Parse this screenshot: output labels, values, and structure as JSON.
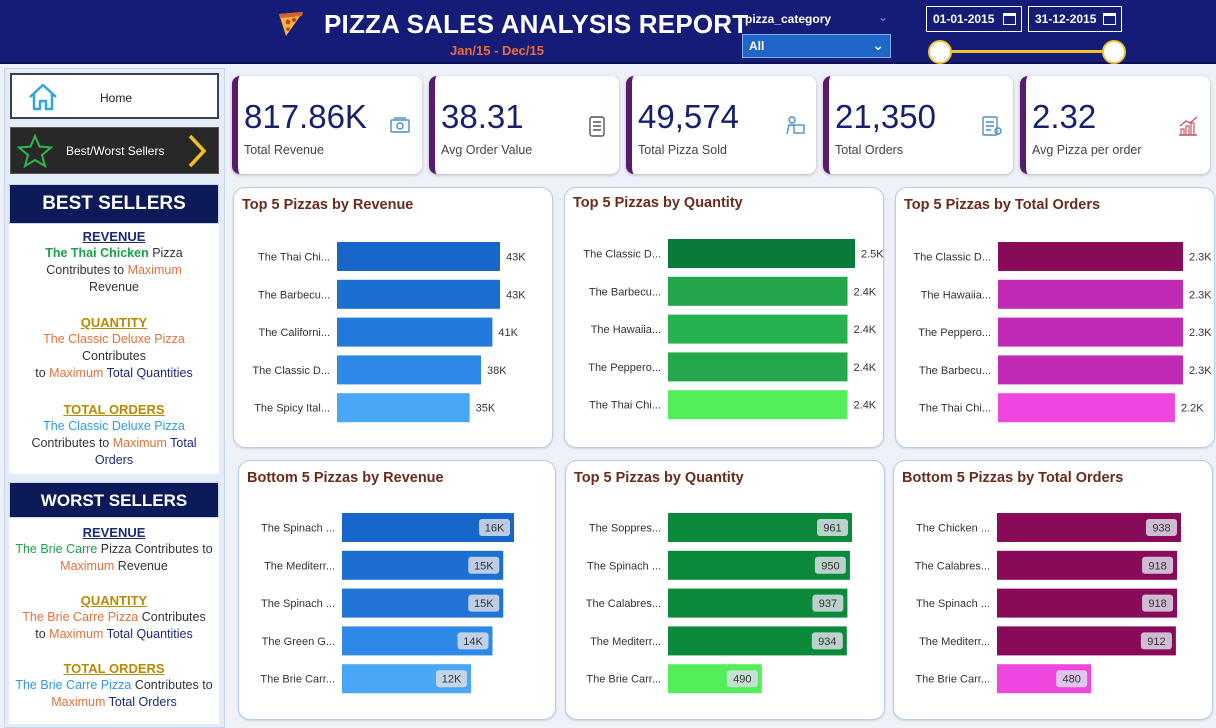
{
  "header": {
    "title": "PIZZA SALES ANALYSIS REPORT",
    "subtitle": "Jan/15 - Dec/15",
    "icon": "pizza-slice-icon"
  },
  "filters": {
    "category_label": "pizza_category",
    "category_value": "All",
    "date_start": "01-01-2015",
    "date_end": "31-12-2015"
  },
  "nav": {
    "home_label": "Home",
    "best_worst_label": "Best/Worst Sellers"
  },
  "best": {
    "title": "BEST SELLERS",
    "revenue_head": "REVENUE",
    "revenue_name": "The Thai  Chicken",
    "revenue_rest1": " Pizza",
    "revenue_rest2": "Contributes to ",
    "revenue_max": "Maximum",
    "revenue_tail": "Revenue",
    "quantity_head": "QUANTITY ",
    "quantity_name": "The Classic Deluxe Pizza",
    "quantity_mid": "Contributes",
    "quantity_to": "to ",
    "quantity_max": "Maximum",
    "quantity_tail": " Total Quantities",
    "orders_head": "TOTAL ORDERS",
    "orders_name": "The Classic Deluxe Pizza",
    "orders_mid": "Contributes to ",
    "orders_max": "Maximum",
    "orders_tail1": " Total",
    "orders_tail2": "Orders"
  },
  "worst": {
    "title": "WORST SELLERS",
    "revenue_head": "REVENUE",
    "revenue_name": "The Brie Carre",
    "revenue_mid": " Pizza Contributes to",
    "revenue_max": "Maximum",
    "revenue_tail": "  Revenue",
    "quantity_head": "QUANTITY ",
    "quantity_name": "The Brie Carre Pizza",
    "quantity_mid": " Contributes",
    "quantity_to": "to ",
    "quantity_max": "Maximum",
    "quantity_tail": " Total Quantities",
    "orders_head": "TOTAL ORDERS",
    "orders_name": "The Brie Carre Pizza",
    "orders_mid": " Contributes to",
    "orders_max": "Maximum",
    "orders_tail": " Total Orders"
  },
  "kpis": [
    {
      "value": "817.86K",
      "label": "Total Revenue",
      "icon": "money-icon"
    },
    {
      "value": "38.31",
      "label": "Avg Order Value",
      "icon": "clipboard-icon"
    },
    {
      "value": "49,574",
      "label": "Total Pizza Sold",
      "icon": "delivery-icon"
    },
    {
      "value": "21,350",
      "label": "Total Orders",
      "icon": "order-list-icon"
    },
    {
      "value": "2.32",
      "label": "Avg Pizza per order",
      "icon": "growth-chart-icon"
    }
  ],
  "colors": {
    "header": "#141c78",
    "revenue": [
      "#1667c9",
      "#1a6fd1",
      "#227bdc",
      "#2e88e8",
      "#4aa6f7"
    ],
    "quantity_top": [
      "#0a7a3a",
      "#22a84a",
      "#26b04e",
      "#24a84b",
      "#52ef5a"
    ],
    "orders_top": [
      "#8a0a5a",
      "#c12ab4",
      "#c12ab4",
      "#c12ab4",
      "#f046e0"
    ],
    "revenue_bottom": [
      "#1667c9",
      "#1a6fd1",
      "#1f74d6",
      "#2e88e8",
      "#4aa6f7"
    ],
    "quantity_bottom": [
      "#0a8a3a",
      "#0a8a3a",
      "#0a8a3a",
      "#0a8a3a",
      "#52ef5a"
    ],
    "orders_bottom": [
      "#8a0a5a",
      "#8a0a5a",
      "#8a0a5a",
      "#8a0a5a",
      "#f046e0"
    ]
  },
  "chart_data": [
    {
      "type": "bar",
      "title": "Top 5 Pizzas by Revenue",
      "categories": [
        "The Thai Chi...",
        "The Barbecu...",
        "The Californi...",
        "The Classic D...",
        "The Spicy Ital..."
      ],
      "values": [
        43,
        43,
        41,
        38,
        35
      ],
      "labels": [
        "43K",
        "43K",
        "41K",
        "38K",
        "35K"
      ]
    },
    {
      "type": "bar",
      "title": "Top 5 Pizzas by Quantity",
      "categories": [
        "The Classic D...",
        "The Barbecu...",
        "The Hawaiia...",
        "The Peppero...",
        "The Thai Chi..."
      ],
      "values": [
        2.5,
        2.4,
        2.4,
        2.4,
        2.4
      ],
      "labels": [
        "2.5K",
        "2.4K",
        "2.4K",
        "2.4K",
        "2.4K"
      ]
    },
    {
      "type": "bar",
      "title": "Top 5 Pizzas by Total Orders",
      "categories": [
        "The Classic D...",
        "The Hawaiia...",
        "The Peppero...",
        "The Barbecu...",
        "The Thai Chi..."
      ],
      "values": [
        2.3,
        2.3,
        2.3,
        2.3,
        2.2
      ],
      "labels": [
        "2.3K",
        "2.3K",
        "2.3K",
        "2.3K",
        "2.2K"
      ]
    },
    {
      "type": "bar",
      "title": "Bottom 5 Pizzas by Revenue",
      "categories": [
        "The Spinach ...",
        "The Mediterr...",
        "The Spinach ...",
        "The Green G...",
        "The Brie Carr..."
      ],
      "values": [
        16,
        15,
        15,
        14,
        12
      ],
      "labels": [
        "16K",
        "15K",
        "15K",
        "14K",
        "12K"
      ]
    },
    {
      "type": "bar",
      "title": "Top 5 Pizzas by Quantity",
      "categories": [
        "The Soppres...",
        "The Spinach ...",
        "The Calabres...",
        "The Mediterr...",
        "The Brie Carr..."
      ],
      "values": [
        961,
        950,
        937,
        934,
        490
      ],
      "labels": [
        "961",
        "950",
        "937",
        "934",
        "490"
      ]
    },
    {
      "type": "bar",
      "title": "Bottom 5 Pizzas by Total Orders",
      "categories": [
        "The Chicken ...",
        "The Calabres...",
        "The Spinach ...",
        "The Mediterr...",
        "The Brie Carr..."
      ],
      "values": [
        938,
        918,
        918,
        912,
        480
      ],
      "labels": [
        "938",
        "918",
        "918",
        "912",
        "480"
      ]
    }
  ]
}
